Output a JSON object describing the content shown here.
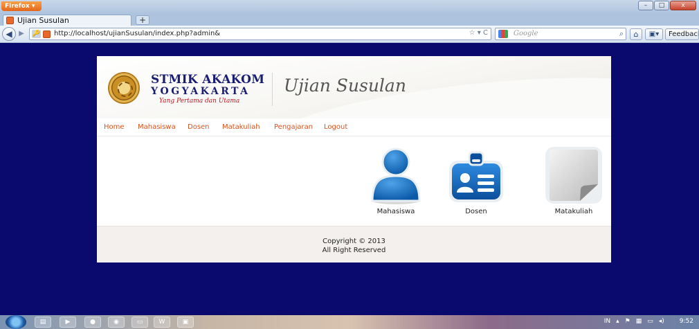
{
  "browser": {
    "menu_button_label": "Firefox",
    "tab_title": "Ujian Susulan",
    "new_tab_symbol": "+",
    "url": "http://localhost/ujianSusulan/index.php?admin&",
    "search_placeholder": "Google",
    "feedback_label": "Feedback",
    "window_controls": [
      "–",
      "□",
      "x"
    ]
  },
  "site": {
    "brand_line1": "STMIK AKAKOM",
    "brand_line2": "YOGYAKARTA",
    "brand_tagline": "Yang Pertama dan Utama",
    "app_title": "Ujian Susulan"
  },
  "menu": {
    "items": [
      "Home",
      "Mahasiswa",
      "Dosen",
      "Matakuliah",
      "Pengajaran",
      "Logout"
    ]
  },
  "dashboard": {
    "items": [
      {
        "label": "Mahasiswa",
        "icon": "user-icon"
      },
      {
        "label": "Dosen",
        "icon": "id-card-icon"
      },
      {
        "label": "Matakuliah",
        "icon": "document-icon"
      }
    ]
  },
  "footer": {
    "copyright": "Copyright © 2013",
    "rights": "All Right Reserved"
  },
  "taskbar": {
    "language": "IN",
    "time": "9:52"
  },
  "colors": {
    "page_background": "#0a0a6e",
    "menu_link": "#d9531e",
    "brand_blue": "#1a1e72",
    "tagline_red": "#c4161c"
  }
}
